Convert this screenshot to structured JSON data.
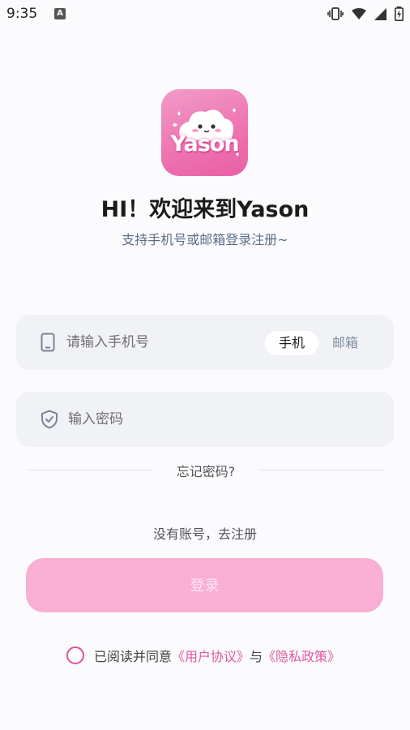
{
  "status_bar": {
    "time": "9:35",
    "notification_glyph": "A"
  },
  "logo": {
    "text": "Yason"
  },
  "title": "HI！欢迎来到Yason",
  "subtitle": "支持手机号或邮箱登录注册~",
  "phone_field": {
    "placeholder": "请输入手机号",
    "value": "",
    "icon": "phone-icon"
  },
  "login_toggle": {
    "phone_label": "手机",
    "email_label": "邮箱",
    "selected": "手机"
  },
  "password_field": {
    "placeholder": "输入密码",
    "value": "",
    "icon": "shield-icon"
  },
  "forgot_password": "忘记密码?",
  "register_link": "没有账号，去注册",
  "login_button": "登录",
  "agreement": {
    "prefix": "已阅读并同意",
    "user_agreement": "《用户协议》",
    "conjunction": "与",
    "privacy_policy": "《隐私政策》",
    "checked": false
  },
  "colors": {
    "accent": "#e357a0",
    "button_disabled": "#f9afd4",
    "field_bg": "#f1f2f5",
    "subtitle": "#5c6d86"
  }
}
